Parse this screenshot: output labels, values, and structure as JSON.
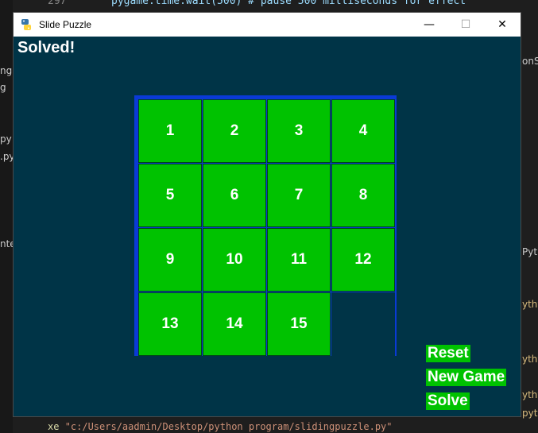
{
  "background": {
    "line_number": "297",
    "code_fragment": "pygame.time.wait(500) # pause 500 milliseconds for effect",
    "left_fragments": [
      "ng",
      "g",
      "py",
      ".py",
      "nte"
    ],
    "right_fragments": [
      "onS",
      "Pyt",
      "ythy",
      "ythy",
      "ythy",
      "pyth"
    ],
    "terminal_prefix": "xe",
    "terminal_path": "\"c:/Users/aadmin/Desktop/python program/slidingpuzzle.py\""
  },
  "window": {
    "title": "Slide Puzzle",
    "controls": {
      "minimize": "—",
      "maximize": "☐",
      "close": "✕"
    }
  },
  "game": {
    "status": "Solved!",
    "tiles": [
      "1",
      "2",
      "3",
      "4",
      "5",
      "6",
      "7",
      "8",
      "9",
      "10",
      "11",
      "12",
      "13",
      "14",
      "15",
      ""
    ],
    "buttons": {
      "reset": "Reset",
      "new_game": "New Game",
      "solve": "Solve"
    }
  },
  "colors": {
    "window_bg": "#003447",
    "tile": "#00c200",
    "board_border": "#0a3ad6",
    "text": "#ffffff"
  }
}
